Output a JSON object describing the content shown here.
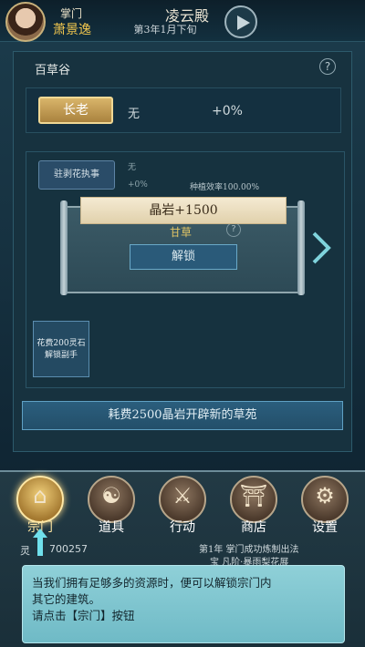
{
  "header": {
    "master_label": "掌门",
    "master_name": "萧景逸",
    "sect_name": "凌云殿",
    "date": "第3年1月下旬"
  },
  "panel": {
    "title": "百草谷",
    "elder_label": "长老",
    "elder_value": "无",
    "elder_bonus": "+0%"
  },
  "garden": {
    "steward_label": "驻剥花执事",
    "steward_value": "无",
    "steward_bonus": "+0%",
    "efficiency": "种植效率100.00%",
    "herb_name": "甘草",
    "unlock_label": "解锁",
    "hire_text": "花费200灵石解锁副手"
  },
  "toast": {
    "text": "晶岩+1500"
  },
  "actions": {
    "open_garden": "耗费2500晶岩开辟新的草苑"
  },
  "nav": {
    "items": [
      {
        "label": "宗门",
        "icon": "sect-gate-icon",
        "glyph": "⌂",
        "active": true
      },
      {
        "label": "道具",
        "icon": "item-bag-icon",
        "glyph": "☯",
        "active": false
      },
      {
        "label": "行动",
        "icon": "action-icon",
        "glyph": "⚔",
        "active": false
      },
      {
        "label": "商店",
        "icon": "shop-icon",
        "glyph": "⛩",
        "active": false
      },
      {
        "label": "设置",
        "icon": "gear-icon",
        "glyph": "⚙",
        "active": false
      }
    ]
  },
  "status": {
    "stone_label": "灵",
    "stone_count": "700257",
    "log_line1": "第1年 掌门成功炼制出法",
    "log_line2": "宝 凡阶·暴雨梨花展"
  },
  "tutorial": {
    "line1": "当我们拥有足够多的资源时，便可以解锁宗门内",
    "line2": "其它的建筑。",
    "line3": "请点击【宗门】按钮"
  },
  "colors": {
    "accent_gold": "#f0c64e",
    "tutorial_bg": "#8fd0d8"
  }
}
